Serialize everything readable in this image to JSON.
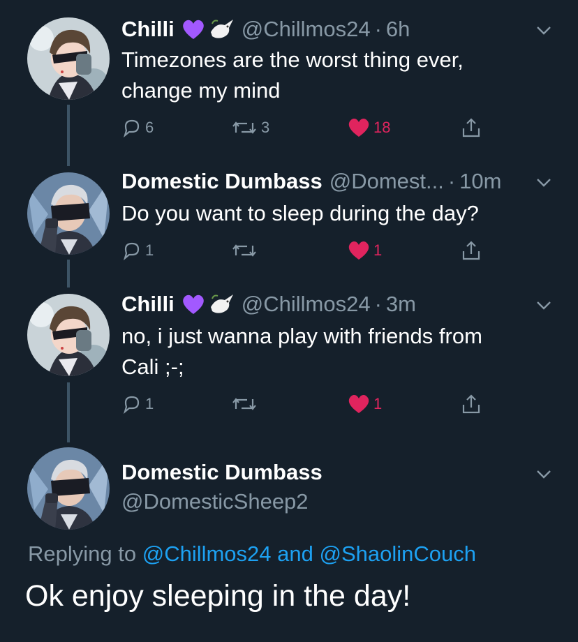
{
  "colors": {
    "background": "#15202b",
    "secondary_text": "#8899a6",
    "link": "#1da1f2",
    "like_red": "#e0245e",
    "heart_purple": "#a259ff"
  },
  "tweets": [
    {
      "name": "Chilli",
      "emojis": [
        "purple-heart-icon",
        "dove-icon"
      ],
      "handle": "@Chillmos24",
      "dot": "·",
      "time": "6h",
      "lines": [
        "Timezones are the worst thing ever,",
        "change my mind"
      ],
      "replies": "6",
      "retweets": "3",
      "likes": "18",
      "avatar": "chilli-avatar"
    },
    {
      "name": "Domestic Dumbass",
      "handle": "@Domest...",
      "dot": "·",
      "time": "10m",
      "lines": [
        "Do you want to sleep during the day?"
      ],
      "replies": "1",
      "retweets": "",
      "likes": "1",
      "avatar": "domestic-avatar"
    },
    {
      "name": "Chilli",
      "emojis": [
        "purple-heart-icon",
        "dove-icon"
      ],
      "handle": "@Chillmos24",
      "dot": "·",
      "time": "3m",
      "lines": [
        "no, i just wanna play with friends from",
        "Cali ;-;"
      ],
      "replies": "1",
      "retweets": "",
      "likes": "1",
      "avatar": "chilli-avatar"
    }
  ],
  "main_tweet": {
    "name": "Domestic Dumbass",
    "handle": "@DomesticSheep2",
    "replying_prefix": "Replying to",
    "mention_1": "@Chillmos24",
    "and_word": "and",
    "mention_2": "@ShaolinCouch",
    "text": "Ok enjoy sleeping in the day!"
  }
}
